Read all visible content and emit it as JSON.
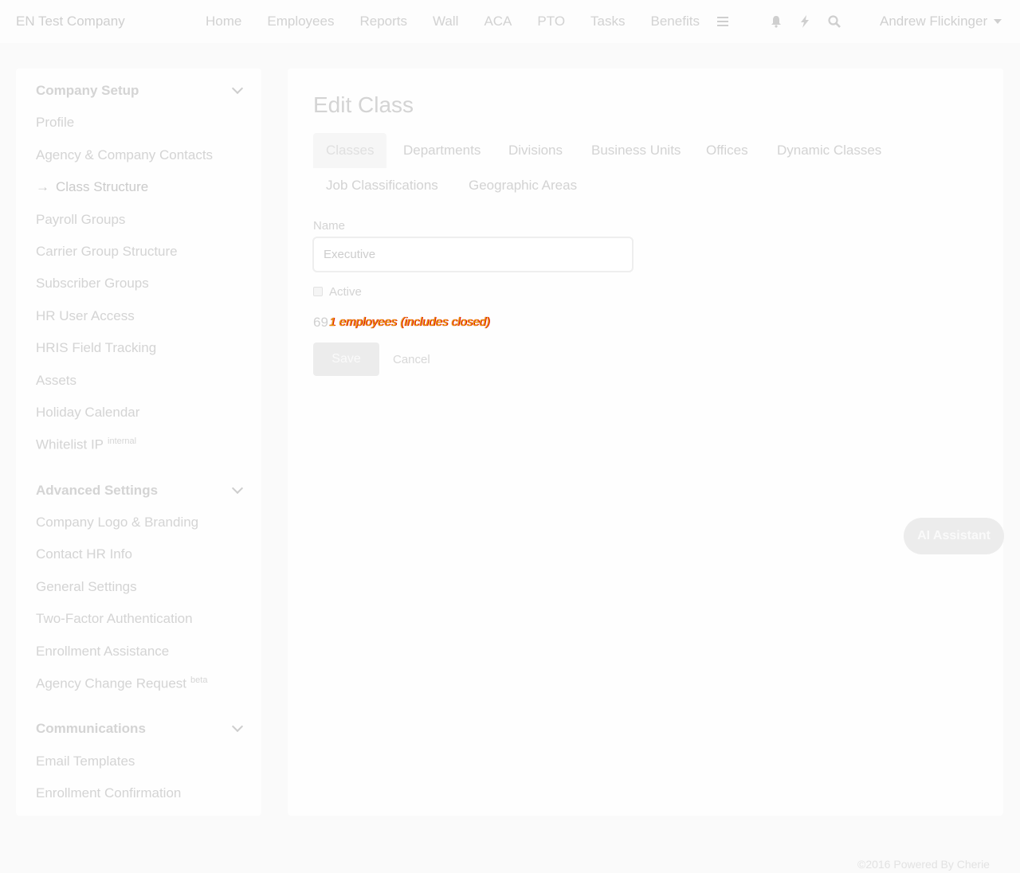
{
  "brand": "EN Test Company",
  "nav": {
    "links": [
      "Home",
      "Employees",
      "Reports",
      "Wall",
      "ACA",
      "PTO",
      "Tasks",
      "Benefits"
    ],
    "user": "Andrew Flickinger"
  },
  "sidebar": {
    "company_setup": {
      "header": "Company Setup",
      "items": [
        "Profile",
        "Agency & Company Contacts",
        "Class Structure",
        "Payroll Groups",
        "Carrier Group Structure",
        "Subscriber Groups",
        "HR User Access",
        "HRIS Field Tracking",
        "Assets",
        "Holiday Calendar",
        "Whitelist IP"
      ],
      "whitelist_badge": "internal"
    },
    "advanced_settings": {
      "header": "Advanced Settings",
      "items": [
        "Company Logo & Branding",
        "Contact HR Info",
        "General Settings",
        "Two-Factor Authentication",
        "Enrollment Assistance",
        "Agency Change Request"
      ],
      "change_request_badge": "beta"
    },
    "communications": {
      "header": "Communications",
      "items": [
        "Email Templates",
        "Enrollment Confirmation"
      ]
    }
  },
  "main": {
    "title": "Edit Class",
    "tabs": [
      "Classes",
      "Departments",
      "Divisions",
      "Business Units",
      "Offices",
      "Dynamic Classes",
      "Job Classifications",
      "Geographic Areas"
    ],
    "name_label": "Name",
    "name_value": "Executive",
    "active_label": "Active",
    "count_prefix": "69",
    "count_text": "1 employees (includes closed)",
    "save_label": "Save",
    "cancel_label": "Cancel"
  },
  "ai_assistant": "AI Assistant",
  "footer": "©2016 Powered By Cherie"
}
